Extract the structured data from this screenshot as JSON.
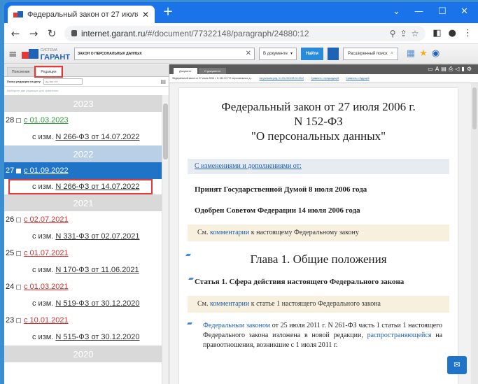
{
  "browser": {
    "tab_title": "Федеральный закон от 27 июля",
    "tab_close": "✕",
    "new_tab": "+",
    "url_host": "internet.garant.ru",
    "url_path": "/#/document/77322148/paragraph/24880:12",
    "win_min": "—",
    "win_max": "☐",
    "win_close": "✕",
    "win_chevron": "⌄"
  },
  "garant_toolbar": {
    "logo": "ГАРАНТ",
    "logo_small": "СИСТЕМА",
    "search_value": "ЗАКОН О ПЕРСОНАЛЬНЫХ ДАННЫХ",
    "scope_select": "В документе",
    "find_button": "Найти",
    "advanced_search": "Расширенный поиск"
  },
  "left_panel": {
    "tab_comments": "Пояснения",
    "tab_editions": "Редакции",
    "date_label": "Поиск редакции на дату",
    "date_placeholder": "дд.мм.гггг",
    "hint": "Выберите две редакции для сравнения",
    "years": [
      "2023",
      "2022",
      "2021",
      "2020"
    ],
    "editions": [
      {
        "num": "28",
        "date": "с 01.03.2023",
        "amend_prefix": "с изм.",
        "amend": "N 266-ФЗ от 14.07.2022"
      },
      {
        "num": "27",
        "date": "с 01.09.2022",
        "amend_prefix": "с изм.",
        "amend": "N 266-ФЗ от 14.07.2022"
      },
      {
        "num": "26",
        "date": "с 02.07.2021",
        "amend_prefix": "с изм.",
        "amend": "N 331-ФЗ от 02.07.2021"
      },
      {
        "num": "25",
        "date": "с 01.07.2021",
        "amend_prefix": "с изм.",
        "amend": "N 170-ФЗ от 11.06.2021"
      },
      {
        "num": "24",
        "date": "с 01.03.2021",
        "amend_prefix": "с изм.",
        "amend": "N 519-ФЗ от 30.12.2020"
      },
      {
        "num": "23",
        "date": "с 10.01.2021",
        "amend_prefix": "с изм.",
        "amend": "N 515-ФЗ от 30.12.2020"
      }
    ]
  },
  "doc_panel": {
    "tab_document": "Документ",
    "tab_about": "О документе",
    "info_title": "Федеральный закон от 27 июля 2006 г. N 152-ФЗ \"О персональных д...",
    "info_actual": "Актуальная ред. 01.09.2022/28.02.2022",
    "info_compare_prev": "Сравнить с предыдущей",
    "info_compare_next": "Сравнить с будущей",
    "title_line1": "Федеральный закон от 27 июля 2006 г.",
    "title_line2": "N 152-ФЗ",
    "title_line3": "\"О персональных данных\"",
    "changes_link": "С изменениями и дополнениями от:",
    "accepted": "Принят Государственной Думой 8 июля 2006 года",
    "approved": "Одобрен Советом Федерации 14 июля 2006 года",
    "note1_prefix": "См.",
    "note1_link": "комментарии",
    "note1_suffix": "к настоящему Федеральному закону",
    "chapter": "Глава 1. Общие положения",
    "article1": "Статья 1. Сфера действия настоящего Федерального закона",
    "note2_prefix": "См.",
    "note2_link": "комментарии",
    "note2_suffix": "к статье 1 настоящего Федерального закона",
    "para_link1": "Федеральным законом",
    "para_text1": "от 25 июля 2011 г. N 261-ФЗ часть 1 статьи 1 настоящего Федерального закона изложена в новой редакции,",
    "para_link2": "распространяющейся",
    "para_text2": "на правоотношения, возникшие с 1 июля 2011 г."
  }
}
